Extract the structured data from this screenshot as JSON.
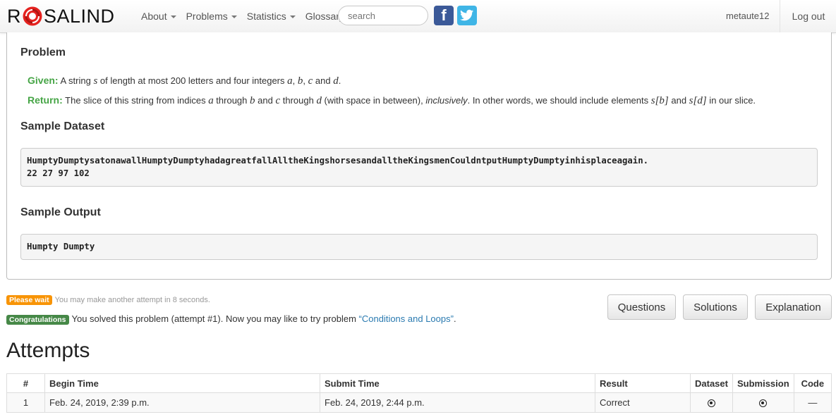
{
  "nav": {
    "brand_r": "R",
    "brand_rest": "SALIND",
    "items": [
      "About",
      "Problems",
      "Statistics",
      "Glossary"
    ],
    "search_placeholder": "search",
    "facebook": "f",
    "twitter": "t",
    "username": "metaute12",
    "logout": "Log out"
  },
  "problem": {
    "heading": "Problem",
    "given_label": "Given:",
    "given_text": [
      " A string ",
      "s",
      " of length at most 200 letters and four integers ",
      "a",
      ", ",
      "b",
      ", ",
      "c",
      " and ",
      "d",
      "."
    ],
    "return_label": "Return:",
    "return_text": [
      " The slice of this string from indices ",
      "a",
      " through ",
      "b",
      " and ",
      "c",
      " through ",
      "d",
      " (with space in between), ",
      "inclusively",
      ". In other words, we should include elements ",
      "s[b]",
      " and ",
      "s[d]",
      " in our slice."
    ],
    "sample_dataset_heading": "Sample Dataset",
    "sample_dataset": "HumptyDumptysatonawallHumptyDumptyhadagreatfallAlltheKingshorsesandalltheKingsmenCouldntputHumptyDumptyinhisplaceagain.\n22 27 97 102",
    "sample_output_heading": "Sample Output",
    "sample_output": "Humpty Dumpty"
  },
  "status": {
    "wait_badge": "Please wait",
    "wait_text": "You may make another attempt in 8 seconds.",
    "congrats_badge": "Congratulations",
    "congrats_text": "You solved this problem (attempt #1). Now you may like to try problem ",
    "next_problem": "“Conditions and Loops”",
    "congrats_end": "."
  },
  "buttons": {
    "questions": "Questions",
    "solutions": "Solutions",
    "explanation": "Explanation"
  },
  "attempts": {
    "title": "Attempts",
    "headers": [
      "#",
      "Begin Time",
      "Submit Time",
      "Result",
      "Dataset",
      "Submission",
      "Code"
    ],
    "rows": [
      {
        "num": "1",
        "begin": "Feb. 24, 2019, 2:39 p.m.",
        "submit": "Feb. 24, 2019, 2:44 p.m.",
        "result": "Correct",
        "code": "—"
      }
    ]
  },
  "colors": {
    "given_green": "#46a546",
    "wait_orange": "#f89406",
    "congrats_green": "#468847",
    "link_blue": "#2a7ab0"
  }
}
